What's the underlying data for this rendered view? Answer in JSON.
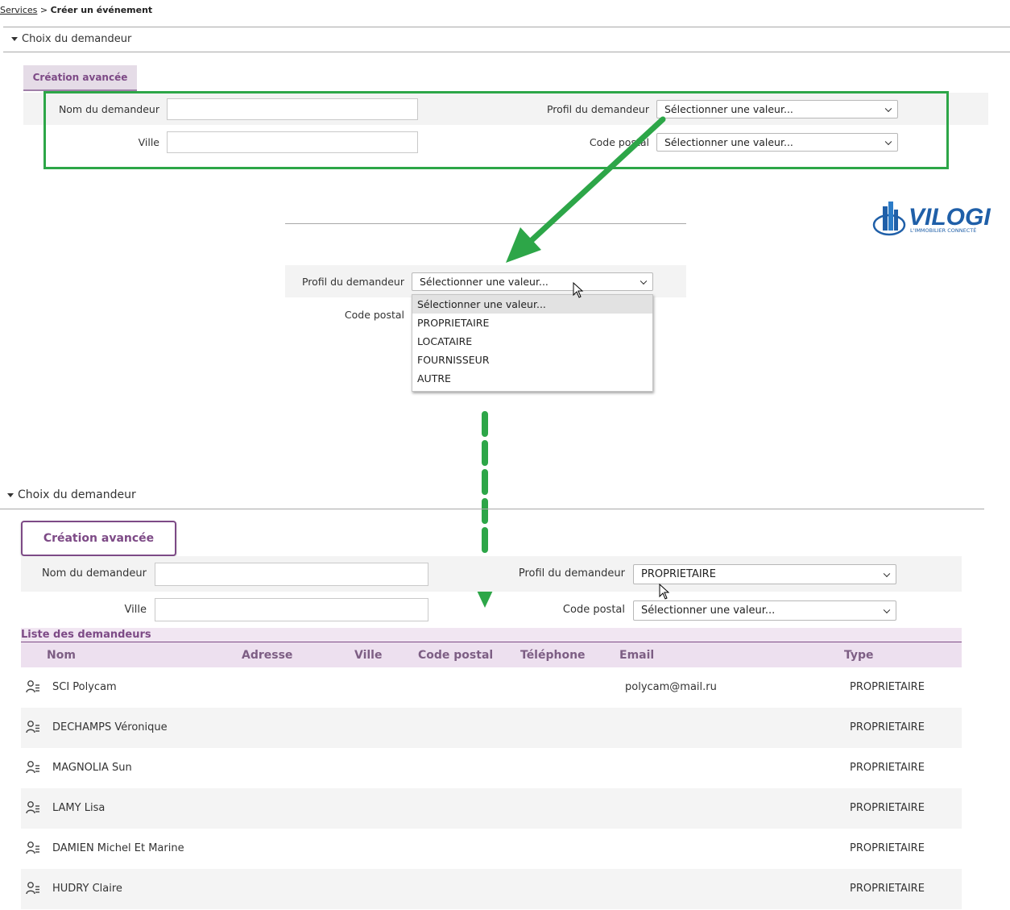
{
  "breadcrumb": {
    "parent": "Services",
    "separator": ">",
    "current": "Créer un événement"
  },
  "section_title": "Choix du demandeur",
  "tab_label": "Création avancée",
  "labels": {
    "nom": "Nom du demandeur",
    "ville": "Ville",
    "profil": "Profil du demandeur",
    "code_postal": "Code postal"
  },
  "select_placeholder": "Sélectionner une valeur...",
  "dropdown_options": [
    "Sélectionner une valeur...",
    "PROPRIETAIRE",
    "LOCATAIRE",
    "FOURNISSEUR",
    "AUTRE"
  ],
  "selected_profil": "PROPRIETAIRE",
  "logo": {
    "name": "VILOGI",
    "tagline": "L'IMMOBILIER CONNECTÉ"
  },
  "list": {
    "title": "Liste des demandeurs",
    "columns": [
      "Nom",
      "Adresse",
      "Ville",
      "Code postal",
      "Téléphone",
      "Email",
      "Type"
    ],
    "rows": [
      {
        "nom": "SCI Polycam",
        "email": "polycam@mail.ru",
        "type": "PROPRIETAIRE"
      },
      {
        "nom": "DECHAMPS Véronique",
        "email": "",
        "type": "PROPRIETAIRE"
      },
      {
        "nom": "MAGNOLIA Sun",
        "email": "",
        "type": "PROPRIETAIRE"
      },
      {
        "nom": "LAMY Lisa",
        "email": "",
        "type": "PROPRIETAIRE"
      },
      {
        "nom": "DAMIEN Michel Et Marine",
        "email": "",
        "type": "PROPRIETAIRE"
      },
      {
        "nom": "HUDRY Claire",
        "email": "",
        "type": "PROPRIETAIRE"
      }
    ]
  },
  "colors": {
    "accent": "#7d4a86",
    "highlight": "#2da648",
    "header_bg": "#ede0ef",
    "logo_blue": "#1f5fa8"
  },
  "icons": [
    "triangle-down-icon",
    "chevron-down-icon",
    "cursor-icon",
    "user-list-icon",
    "green-arrow-icon",
    "dashed-arrow-icon"
  ]
}
